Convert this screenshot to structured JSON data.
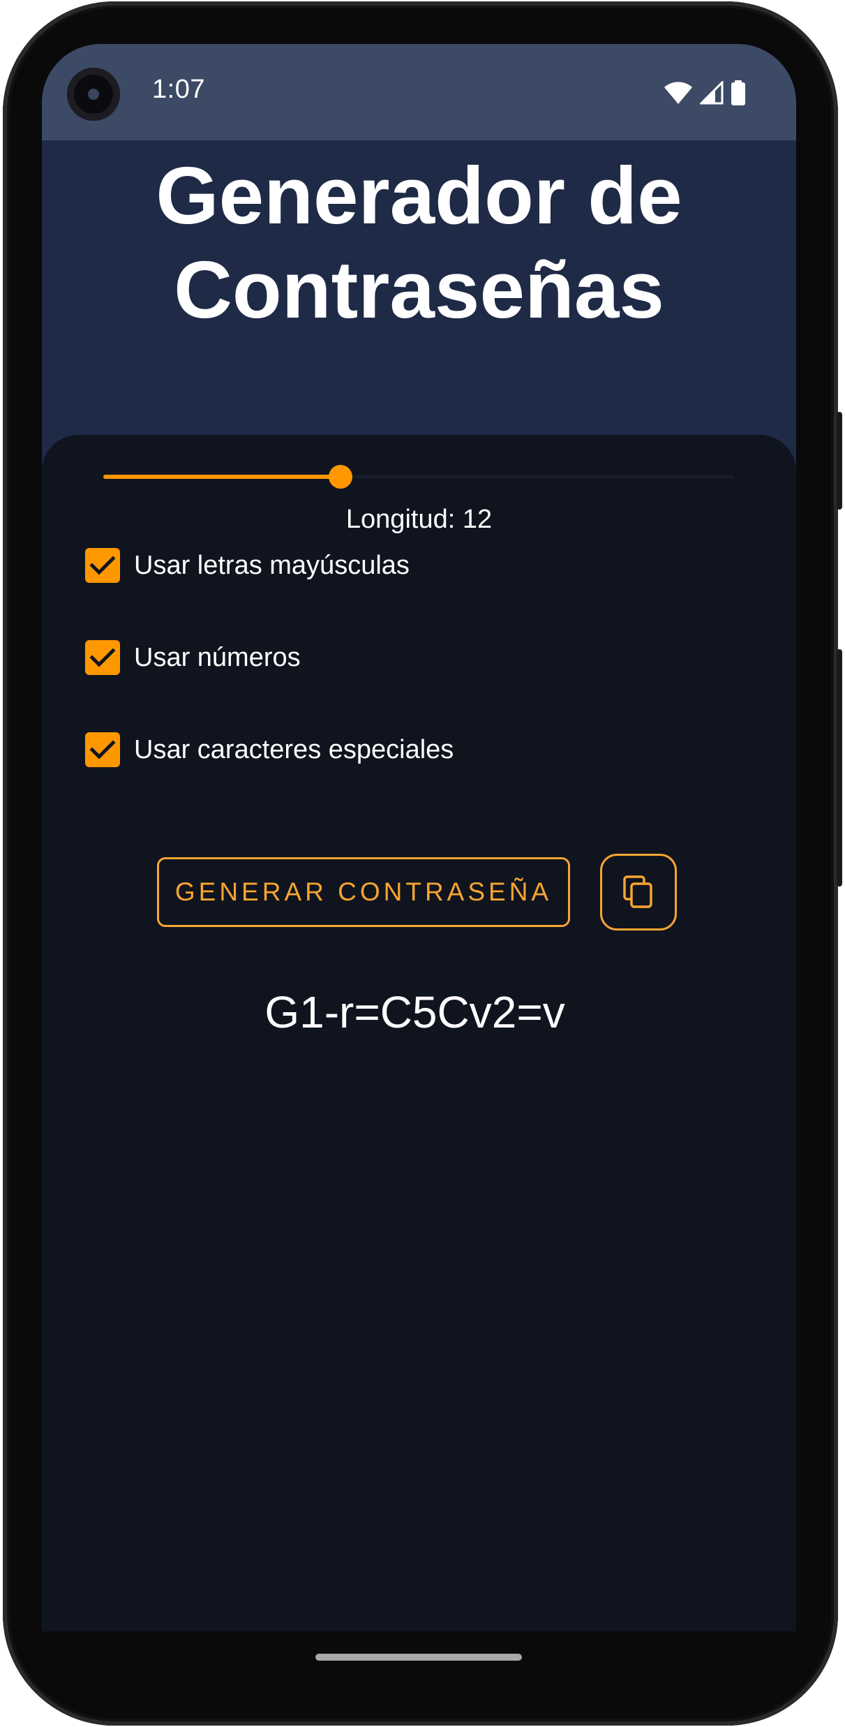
{
  "status_bar": {
    "time": "1:07",
    "icons": [
      "camera-icon",
      "wifi-icon",
      "signal-icon",
      "battery-icon"
    ]
  },
  "header": {
    "title_line1": "Generador de",
    "title_line2": "Contraseñas"
  },
  "slider": {
    "value": 12,
    "fraction": 0.376,
    "label": "Longitud: 12"
  },
  "options": [
    {
      "label": "Usar letras mayúsculas",
      "checked": true
    },
    {
      "label": "Usar números",
      "checked": true
    },
    {
      "label": "Usar caracteres especiales",
      "checked": true
    }
  ],
  "actions": {
    "generate_label": "GENERAR CONTRASEÑA",
    "copy_icon": "copy-icon"
  },
  "result": {
    "password": "G1-r=C5Cv2=v"
  },
  "colors": {
    "accent": "#ff9800",
    "button_outline": "#f7a531",
    "header_bg": "#1f2a47",
    "status_bg": "#3c4a66",
    "card_bg": "#10141f",
    "text": "#ffffff"
  }
}
